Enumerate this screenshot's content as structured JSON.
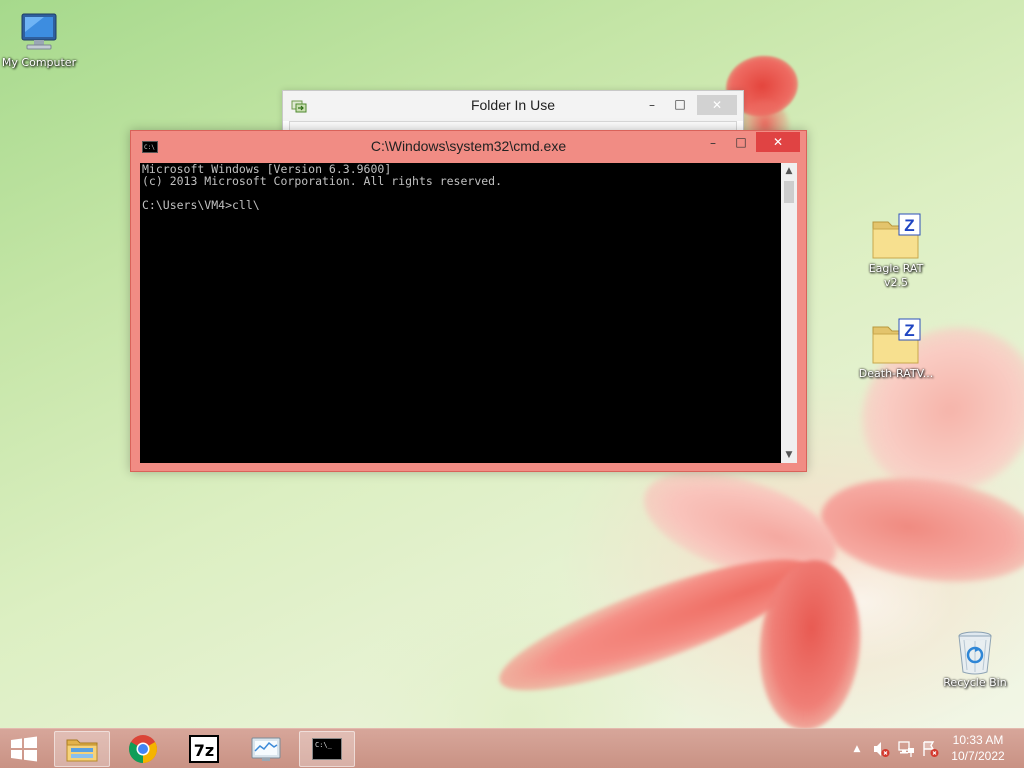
{
  "desktop": {
    "icons": [
      {
        "label": "My Computer",
        "icon": "computer-icon"
      },
      {
        "label": "Eagle RAT v2.5",
        "icon": "winzip-archive-icon"
      },
      {
        "label": "Death-RATV...",
        "icon": "winzip-archive-icon"
      },
      {
        "label": "Recycle Bin",
        "icon": "recycle-bin-icon"
      }
    ]
  },
  "folder_window": {
    "title": "Folder In Use",
    "icon": "folder-in-use-icon"
  },
  "cmd_window": {
    "title": "C:\\Windows\\system32\\cmd.exe",
    "icon_text": "C:\\",
    "lines": [
      "Microsoft Windows [Version 6.3.9600]",
      "(c) 2013 Microsoft Corporation. All rights reserved.",
      "",
      "C:\\Users\\VM4>cll\\"
    ]
  },
  "taskbar": {
    "start_icon": "windows-logo-icon",
    "pinned": [
      {
        "name": "file-explorer",
        "icon": "file-explorer-icon",
        "active": true
      },
      {
        "name": "chrome",
        "icon": "chrome-icon",
        "active": false
      },
      {
        "name": "7zip",
        "icon": "7zip-icon",
        "label": "7z",
        "active": false
      },
      {
        "name": "resource-monitor",
        "icon": "resource-monitor-icon",
        "active": false
      },
      {
        "name": "cmd",
        "icon": "cmd-icon",
        "label": "C:\\_",
        "active": true
      }
    ],
    "tray": {
      "icons": [
        "show-hidden-icons",
        "volume-muted-icon",
        "network-icon",
        "action-center-icon"
      ]
    },
    "clock": {
      "time": "10:33 AM",
      "date": "10/7/2022"
    }
  },
  "colors": {
    "cmd_frame": "#f18c84",
    "taskbar": "#cc9789"
  }
}
